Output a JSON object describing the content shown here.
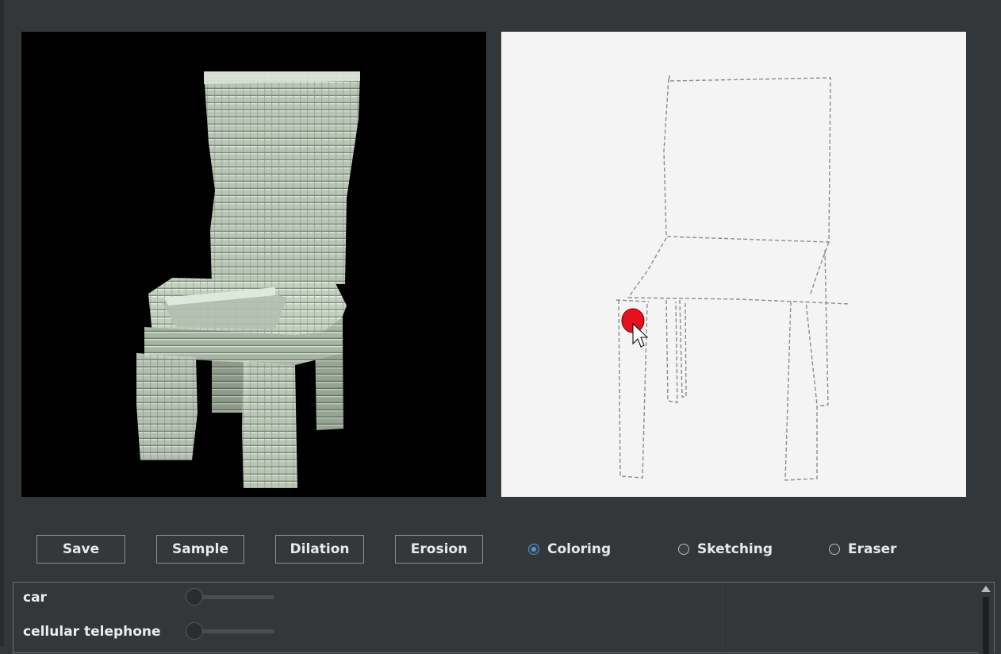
{
  "panels": {
    "voxel_view": {
      "label": "voxel-chair-render"
    },
    "sketch_canvas": {
      "label": "chair-sketch"
    }
  },
  "toolbar": {
    "save_label": "Save",
    "sample_label": "Sample",
    "dilation_label": "Dilation",
    "erosion_label": "Erosion"
  },
  "modes": {
    "coloring_label": "Coloring",
    "sketching_label": "Sketching",
    "eraser_label": "Eraser",
    "selected": "Coloring"
  },
  "categories": [
    {
      "label": "car",
      "value": 0
    },
    {
      "label": "cellular telephone",
      "value": 0
    }
  ],
  "colors": {
    "accent": "#4a98d8",
    "brush": "#e5101d",
    "voxel": "#c9d6c6",
    "background": "#33373a"
  },
  "icons": {
    "cursor": "arrow-cursor-icon",
    "scroll_up": "scroll-up-arrow-icon"
  }
}
